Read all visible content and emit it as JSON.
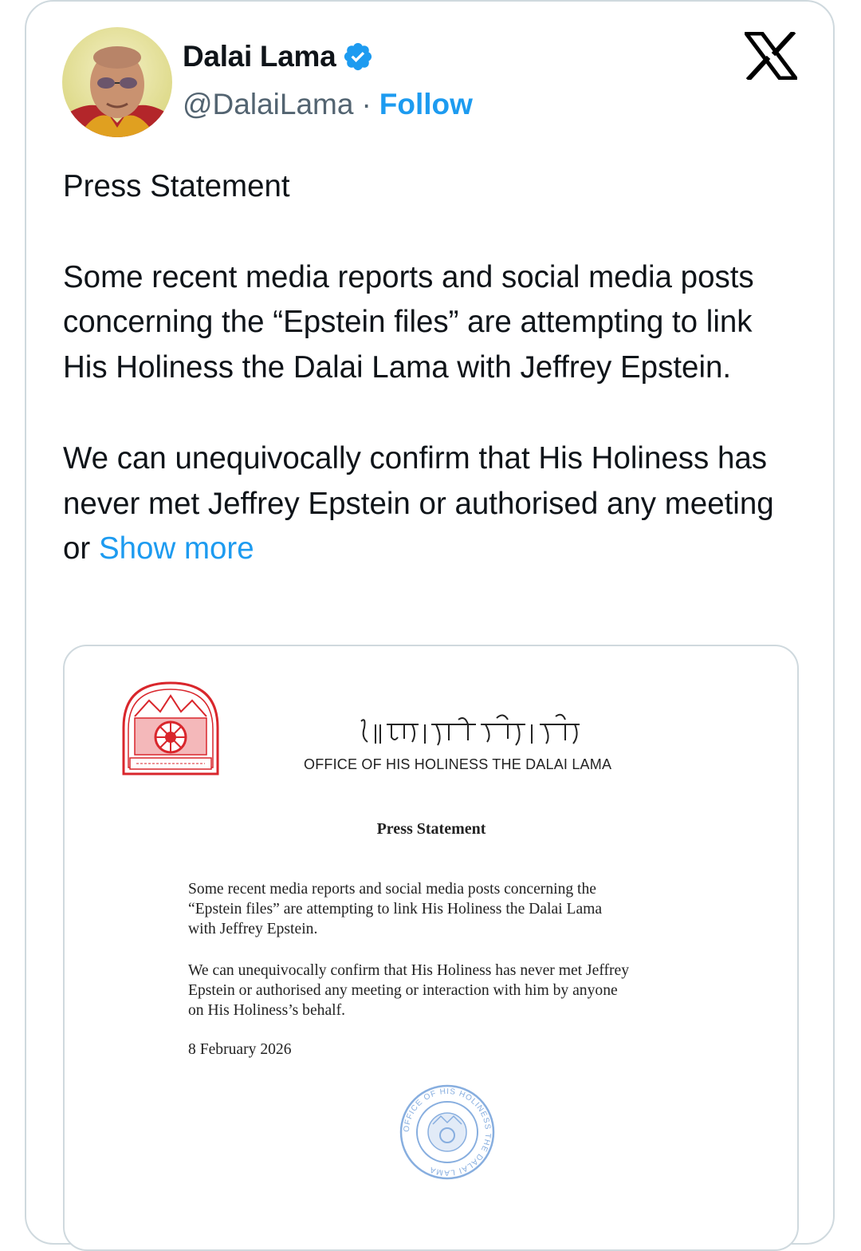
{
  "author": {
    "name": "Dalai Lama",
    "handle": "@DalaiLama",
    "separator": "·",
    "follow_label": "Follow",
    "verified": true
  },
  "platform_logo": "x-logo-icon",
  "tweet": {
    "title": "Press Statement",
    "paragraph1": "Some recent media reports and social media posts concerning the “Epstein files” are attempting to link His Holiness the Dalai Lama with Jeffrey Epstein.",
    "paragraph2_truncated": "We can unequivocally confirm that His Holiness has never met Jeffrey Epstein or authorised any meeting or",
    "show_more_label": "Show more"
  },
  "document": {
    "letterhead_tibetan": "༄།སྐུ་ཞབས་ཀྱི་ཡིག་ཚང་།",
    "office": "OFFICE OF HIS HOLINESS THE DALAI LAMA",
    "title": "Press Statement",
    "para1_line1": "Some recent media reports and social media posts concerning the",
    "para1_line2": "“Epstein files” are attempting to link His Holiness the Dalai Lama",
    "para1_line3": "with Jeffrey Epstein.",
    "para2_line1": "We can unequivocally confirm that His Holiness has never met Jeffrey",
    "para2_line2": "Epstein or authorised any meeting or interaction with him by anyone",
    "para2_line3": "on His Holiness’s behalf.",
    "date": "8 February 2026",
    "stamp_text": "OFFICE OF HIS HOLINESS THE DALAI LAMA"
  },
  "colors": {
    "accent": "#1d9bf0",
    "text": "#0f1419",
    "secondary": "#536471",
    "border": "#cfd9de",
    "seal_red": "#d9262c",
    "stamp_blue": "#6a9ad8"
  }
}
